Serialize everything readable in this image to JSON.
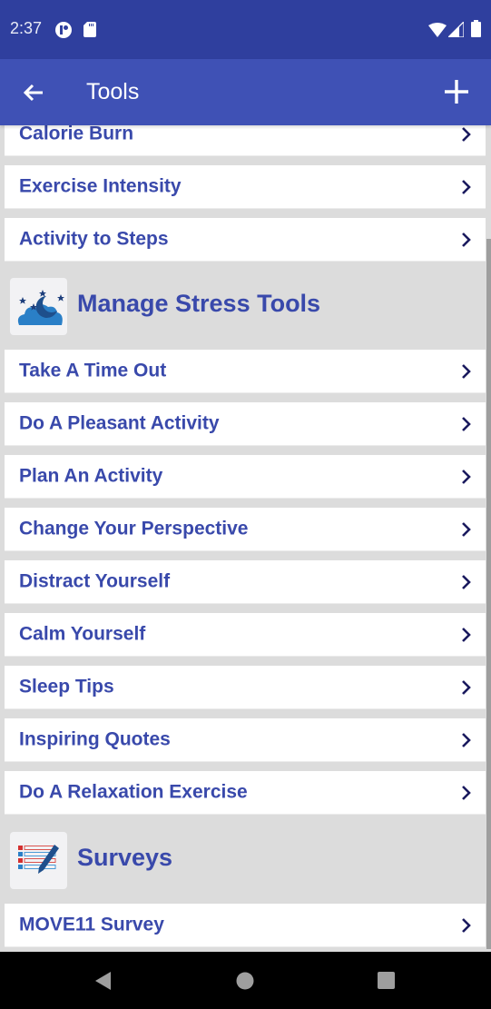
{
  "status_bar": {
    "time": "2:37",
    "left_icons": [
      "notification-app-icon",
      "sd-card-icon"
    ],
    "right_icons": [
      "wifi-icon",
      "cell-signal-icon",
      "battery-icon"
    ]
  },
  "app_bar": {
    "title": "Tools",
    "back_icon": "arrow-left-icon",
    "action_icon": "plus-icon"
  },
  "lists": {
    "top_items": [
      {
        "label": "Calorie Burn"
      },
      {
        "label": "Exercise Intensity"
      },
      {
        "label": "Activity to Steps"
      }
    ],
    "sections": [
      {
        "title": "Manage Stress Tools",
        "icon": "night-cloud-moon-icon",
        "items": [
          {
            "label": "Take A Time Out"
          },
          {
            "label": "Do A Pleasant Activity"
          },
          {
            "label": "Plan An Activity"
          },
          {
            "label": "Change Your Perspective"
          },
          {
            "label": "Distract Yourself"
          },
          {
            "label": "Calm Yourself"
          },
          {
            "label": "Sleep Tips"
          },
          {
            "label": "Inspiring Quotes"
          },
          {
            "label": "Do A Relaxation Exercise"
          }
        ]
      },
      {
        "title": "Surveys",
        "icon": "survey-checklist-icon",
        "items": [
          {
            "label": "MOVE11 Survey"
          }
        ]
      }
    ]
  },
  "nav_bar": {
    "buttons": [
      "back-triangle-icon",
      "home-circle-icon",
      "recents-square-icon"
    ]
  },
  "colors": {
    "status_bar": "#2f3f9e",
    "app_bar": "#3f51b5",
    "accent_text": "#3949ab",
    "chevron": "#1a1a5e",
    "list_background": "#dcdcdc"
  }
}
